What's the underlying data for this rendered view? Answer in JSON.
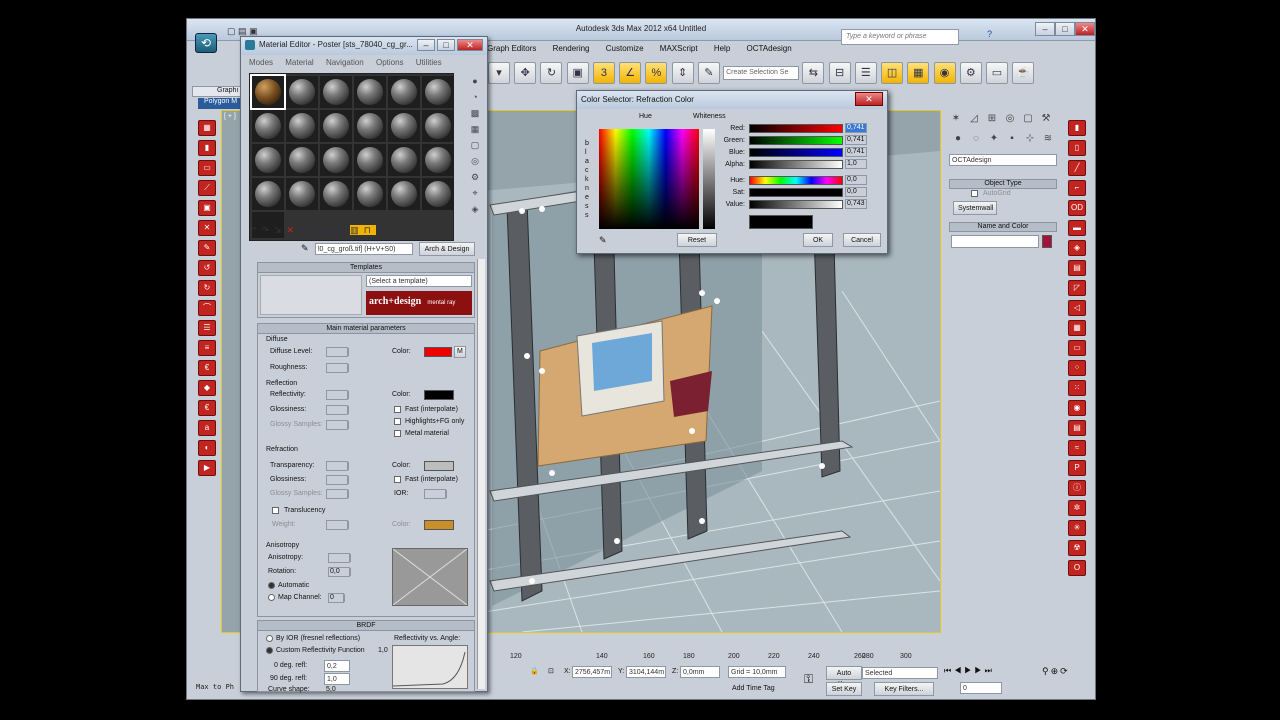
{
  "app": {
    "title": "Autodesk 3ds Max 2012 x64      Untitled",
    "search_placeholder": "Type a keyword or phrase",
    "menus": [
      "Graph Editors",
      "Rendering",
      "Customize",
      "MAXScript",
      "Help",
      "OCTAdesign"
    ],
    "selection_set_placeholder": "Create Selection Se",
    "viewport_label": "[ + ]",
    "left_tabs": [
      "Graphi",
      "Polygon M"
    ],
    "maxscript_prompt": "Max to Ph",
    "brand_color": "#c22420",
    "highlight_color": "#f2b400"
  },
  "command_panel": {
    "object_dropdown": "OCTAdesign",
    "object_type_header": "Object Type",
    "autogrid_label": "AutoGrid",
    "systemwall_button": "Systemwall",
    "name_color_header": "Name and Color",
    "object_color": "#a0143c"
  },
  "material_editor": {
    "title": "Material Editor - Poster [sts_78040_cg_gr...",
    "menus": [
      "Modes",
      "Material",
      "Navigation",
      "Options",
      "Utilities"
    ],
    "material_name": "l0_cg_groß.tif] (H+V+S0)",
    "material_type": "Arch & Design",
    "templates_header": "Templates",
    "template_select": "(Select a template)",
    "brand_logo_text": "arch+design",
    "brand_logo_sub": "mental ray",
    "main_params_header": "Main material parameters",
    "diffuse": {
      "group": "Diffuse",
      "level_label": "Diffuse Level:",
      "roughness_label": "Roughness:",
      "color_label": "Color:",
      "color": "#ee0000",
      "map_button": "M"
    },
    "reflection": {
      "group": "Reflection",
      "reflectivity_label": "Reflectivity:",
      "glossiness_label": "Glossiness:",
      "glossy_samples_label": "Glossy Samples:",
      "color_label": "Color:",
      "color": "#000000",
      "fast_label": "Fast (interpolate)",
      "highlights_label": "Highlights+FG only",
      "metal_label": "Metal material"
    },
    "refraction": {
      "group": "Refraction",
      "transparency_label": "Transparency:",
      "glossiness_label": "Glossiness:",
      "glossy_samples_label": "Glossy Samples:",
      "color_label": "Color:",
      "color": "#bdbdbd",
      "fast_label": "Fast (interpolate)",
      "ior_label": "IOR:"
    },
    "translucency": {
      "label": "Translucency",
      "weight_label": "Weight:",
      "color_label": "Color:",
      "color": "#c8902a"
    },
    "anisotropy": {
      "group": "Anisotropy",
      "anisotropy_label": "Anisotropy:",
      "rotation_label": "Rotation:",
      "rotation_value": "0,0",
      "automatic_label": "Automatic",
      "map_channel_label": "Map Channel:",
      "map_channel_value": "0"
    },
    "brdf": {
      "header": "BRDF",
      "by_ior_label": "By IOR (fresnel reflections)",
      "custom_label": "Custom Reflectivity Function",
      "zero_deg_label": "0 deg. refl:",
      "zero_deg_value": "0,2",
      "ninety_deg_label": "90 deg. refl:",
      "ninety_deg_value": "1,0",
      "curve_label": "Curve shape:",
      "curve_value": "5,0",
      "graph_label": "Reflectivity vs. Angle:",
      "graph_value": "1,0"
    }
  },
  "color_selector": {
    "title": "Color Selector: Refraction Color",
    "hue_label": "Hue",
    "whiteness_label": "Whiteness",
    "blackness_label": "b l a c k n e s s",
    "rows": [
      {
        "label": "Red:",
        "value": "0,741"
      },
      {
        "label": "Green:",
        "value": "0,741"
      },
      {
        "label": "Blue:",
        "value": "0,741"
      },
      {
        "label": "Alpha:",
        "value": "1,0"
      },
      {
        "label": "Hue:",
        "value": "0,0"
      },
      {
        "label": "Sat:",
        "value": "0,0"
      },
      {
        "label": "Value:",
        "value": "0,743"
      }
    ],
    "current_color": "#000000",
    "reset_button": "Reset",
    "ok_button": "OK",
    "cancel_button": "Cancel"
  },
  "status": {
    "ruler_ticks": [
      "120",
      "140",
      "160",
      "180",
      "200",
      "220",
      "240",
      "260",
      "280",
      "300"
    ],
    "x_label": "X:",
    "x_value": "2756,457m",
    "y_label": "Y:",
    "y_value": "3104,144m",
    "z_label": "Z:",
    "z_value": "0,0mm",
    "grid": "Grid = 10,0mm",
    "add_time_tag": "Add Time Tag",
    "auto_key": "Auto Key",
    "set_key": "Set Key",
    "selected": "Selected",
    "key_filters": "Key Filters...",
    "frame": "0"
  }
}
